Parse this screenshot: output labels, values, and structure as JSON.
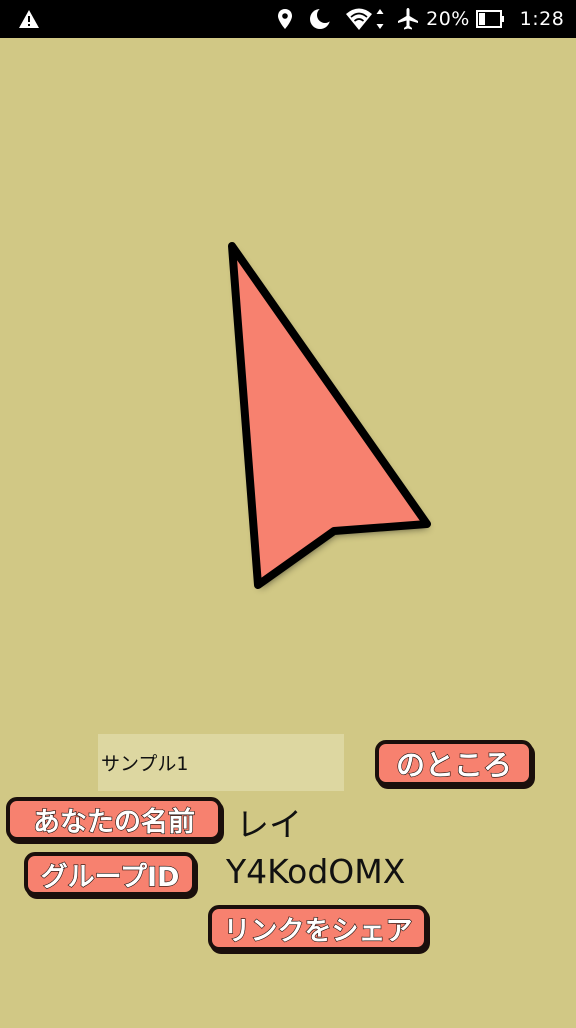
{
  "status_bar": {
    "battery_percent": "20%",
    "time": "1:28",
    "icons": [
      "warning-icon",
      "location-icon",
      "moon-icon",
      "wifi-icon",
      "airplane-icon",
      "battery-icon"
    ]
  },
  "pointer": {
    "icon": "direction-arrow-icon",
    "fill_color": "#f7816f"
  },
  "form": {
    "name_input_value": "サンプル1",
    "location_suffix": "のところ",
    "your_name_label": "あなたの名前",
    "your_name_value": "レイ",
    "group_id_label": "グループID",
    "group_id_value": "Y4KodOMX",
    "share_link_label": "リンクをシェア"
  },
  "colors": {
    "background": "#d1c885",
    "badge": "#f7816f",
    "input_background": "#ddd7a1"
  }
}
